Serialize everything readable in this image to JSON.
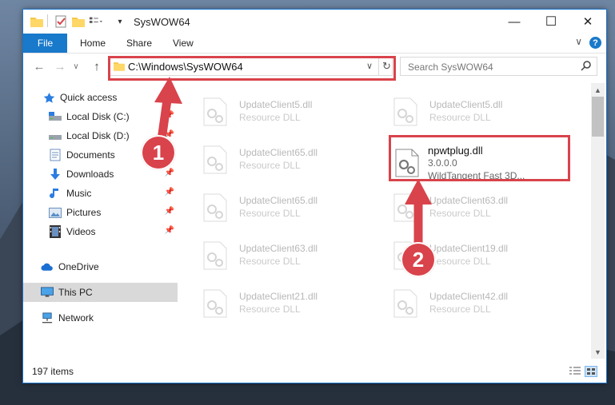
{
  "window": {
    "title": "SysWOW64",
    "buttons": {
      "minimize": "—",
      "maximize": "☐",
      "close": "✕"
    }
  },
  "ribbon": {
    "file_tab": "File",
    "tabs": [
      "Home",
      "Share",
      "View"
    ],
    "help": "?"
  },
  "nav": {
    "address": "C:\\Windows\\SysWOW64",
    "search_placeholder": "Search SysWOW64"
  },
  "sidebar": {
    "items": [
      {
        "label": "Quick access",
        "icon": "star-icon",
        "pinned": false
      },
      {
        "label": "Local Disk (C:)",
        "icon": "drive-icon",
        "pinned": true
      },
      {
        "label": "Local Disk (D:)",
        "icon": "drive-icon",
        "pinned": true
      },
      {
        "label": "Documents",
        "icon": "documents-icon",
        "pinned": true
      },
      {
        "label": "Downloads",
        "icon": "download-icon",
        "pinned": true
      },
      {
        "label": "Music",
        "icon": "music-icon",
        "pinned": true
      },
      {
        "label": "Pictures",
        "icon": "pictures-icon",
        "pinned": true
      },
      {
        "label": "Videos",
        "icon": "videos-icon",
        "pinned": true
      },
      {
        "label": "OneDrive",
        "icon": "cloud-icon",
        "pinned": false
      },
      {
        "label": "This PC",
        "icon": "pc-icon",
        "pinned": false
      },
      {
        "label": "Network",
        "icon": "network-icon",
        "pinned": false
      }
    ]
  },
  "files": {
    "left_column": [
      {
        "name": "UpdateClient5.dll",
        "type": "Resource DLL"
      },
      {
        "name": "UpdateClient65.dll",
        "type": "Resource DLL"
      },
      {
        "name": "UpdateClient65.dll",
        "type": "Resource DLL"
      },
      {
        "name": "UpdateClient63.dll",
        "type": "Resource DLL"
      },
      {
        "name": "UpdateClient21.dll",
        "type": "Resource DLL"
      }
    ],
    "right_column": [
      {
        "name": "UpdateClient5.dll",
        "type": "Resource DLL"
      },
      {
        "name": "UpdateClient63.dll",
        "type": "Resource DLL"
      },
      {
        "name": "UpdateClient19.dll",
        "type": "Resource DLL"
      },
      {
        "name": "UpdateClient42.dll",
        "type": "Resource DLL"
      }
    ],
    "highlighted": {
      "name": "npwtplug.dll",
      "version": "3.0.0.0",
      "description": "WildTangent Fast 3D..."
    }
  },
  "status": {
    "count": "197 items"
  },
  "annotations": {
    "step1": "1",
    "step2": "2",
    "color": "#d9434b"
  }
}
